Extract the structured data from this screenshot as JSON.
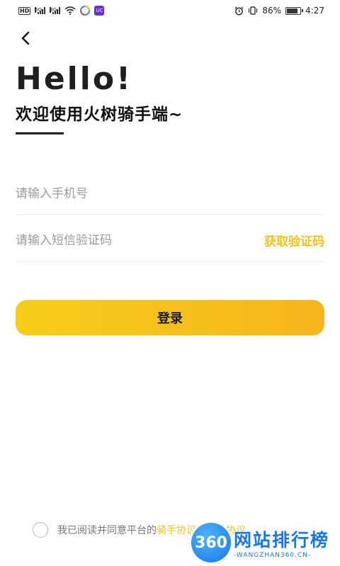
{
  "status_bar": {
    "badge_hd": "HD",
    "signal1_label": "5G",
    "signal2_label": "3G",
    "app_badge": "UC",
    "battery_text": "86%",
    "battery_level": 0.86,
    "time": "4:27"
  },
  "header": {
    "hello": "Hello!",
    "welcome": "欢迎使用火树骑手端~"
  },
  "form": {
    "phone_placeholder": "请输入手机号",
    "phone_value": "",
    "code_placeholder": "请输入短信验证码",
    "code_value": "",
    "get_code_label": "获取验证码",
    "login_label": "登录"
  },
  "agreement": {
    "prefix": "我已阅读并同意平台的",
    "link1": "骑手协议",
    "middle": "和",
    "link2": "隐私协议"
  },
  "watermark": {
    "circle": "360",
    "title": "网站排行榜",
    "sub": "-WANGZHAN360.CN-"
  },
  "colors": {
    "accent": "#f2c21a",
    "button_gradient_start": "#f8cc1a",
    "button_gradient_end": "#f5b51b",
    "watermark_blue": "#1677e5"
  }
}
